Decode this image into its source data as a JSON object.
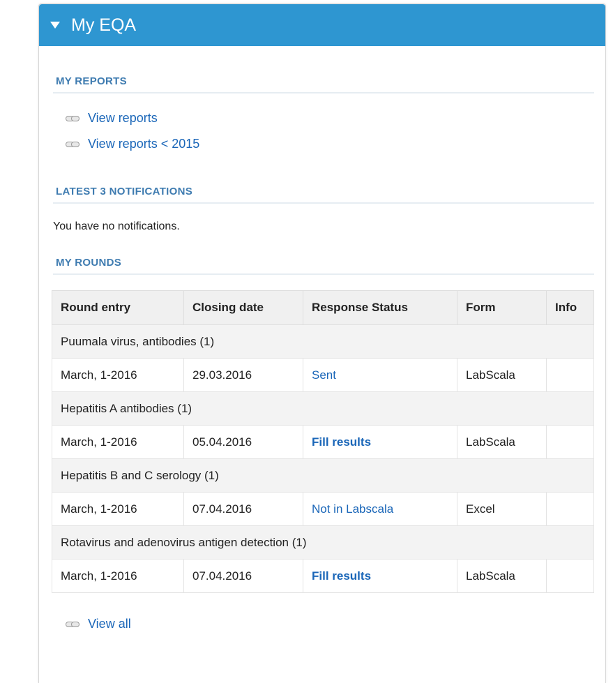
{
  "panel": {
    "title": "My EQA"
  },
  "my_reports": {
    "heading": "MY REPORTS",
    "links": [
      {
        "label": "View reports",
        "icon": "link-icon"
      },
      {
        "label": "View reports < 2015",
        "icon": "link-icon"
      }
    ]
  },
  "notifications": {
    "heading": "LATEST 3 NOTIFICATIONS",
    "empty_message": "You have no notifications."
  },
  "my_rounds": {
    "heading": "MY ROUNDS",
    "columns": [
      "Round entry",
      "Closing date",
      "Response Status",
      "Form",
      "Info"
    ],
    "groups": [
      {
        "name": "Puumala virus, antibodies (1)",
        "entry": {
          "round": "March, 1-2016",
          "closing": "29.03.2016",
          "status": "Sent",
          "status_bold": false,
          "form": "LabScala",
          "info": ""
        }
      },
      {
        "name": "Hepatitis A antibodies (1)",
        "entry": {
          "round": "March, 1-2016",
          "closing": "05.04.2016",
          "status": "Fill results",
          "status_bold": true,
          "form": "LabScala",
          "info": ""
        }
      },
      {
        "name": "Hepatitis B and C serology (1)",
        "entry": {
          "round": "March, 1-2016",
          "closing": "07.04.2016",
          "status": "Not in Labscala",
          "status_bold": false,
          "form": "Excel",
          "info": ""
        }
      },
      {
        "name": "Rotavirus and adenovirus antigen detection (1)",
        "entry": {
          "round": "March, 1-2016",
          "closing": "07.04.2016",
          "status": "Fill results",
          "status_bold": true,
          "form": "LabScala",
          "info": ""
        }
      }
    ],
    "view_all_label": "View all"
  },
  "colors": {
    "header_bg": "#2e96d1",
    "section_title": "#3e7bb0",
    "link": "#1a66b8"
  }
}
